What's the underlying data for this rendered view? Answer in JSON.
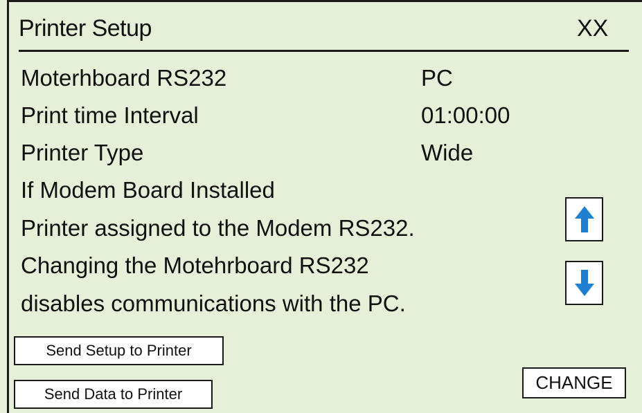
{
  "header": {
    "title": "Printer Setup",
    "close_label": "XX"
  },
  "settings": [
    {
      "label": "Moterhboard RS232",
      "value": "PC"
    },
    {
      "label": "Print time Interval",
      "value": "01:00:00"
    },
    {
      "label": "Printer Type",
      "value": "Wide"
    }
  ],
  "notice": {
    "lines": [
      "If Modem Board Installed",
      "Printer assigned to the Modem RS232.",
      "Changing the Motehrboard RS232",
      "disables communications with the PC."
    ]
  },
  "buttons": {
    "send_setup": "Send Setup to Printer",
    "send_data": "Send Data to Printer",
    "change": "CHANGE"
  },
  "icons": {
    "scroll_up": "arrow-up-icon",
    "scroll_down": "arrow-down-icon"
  },
  "colors": {
    "screen_bg": "#e6f0d8",
    "arrow_blue": "#1f7fd0",
    "ink": "#111111"
  }
}
